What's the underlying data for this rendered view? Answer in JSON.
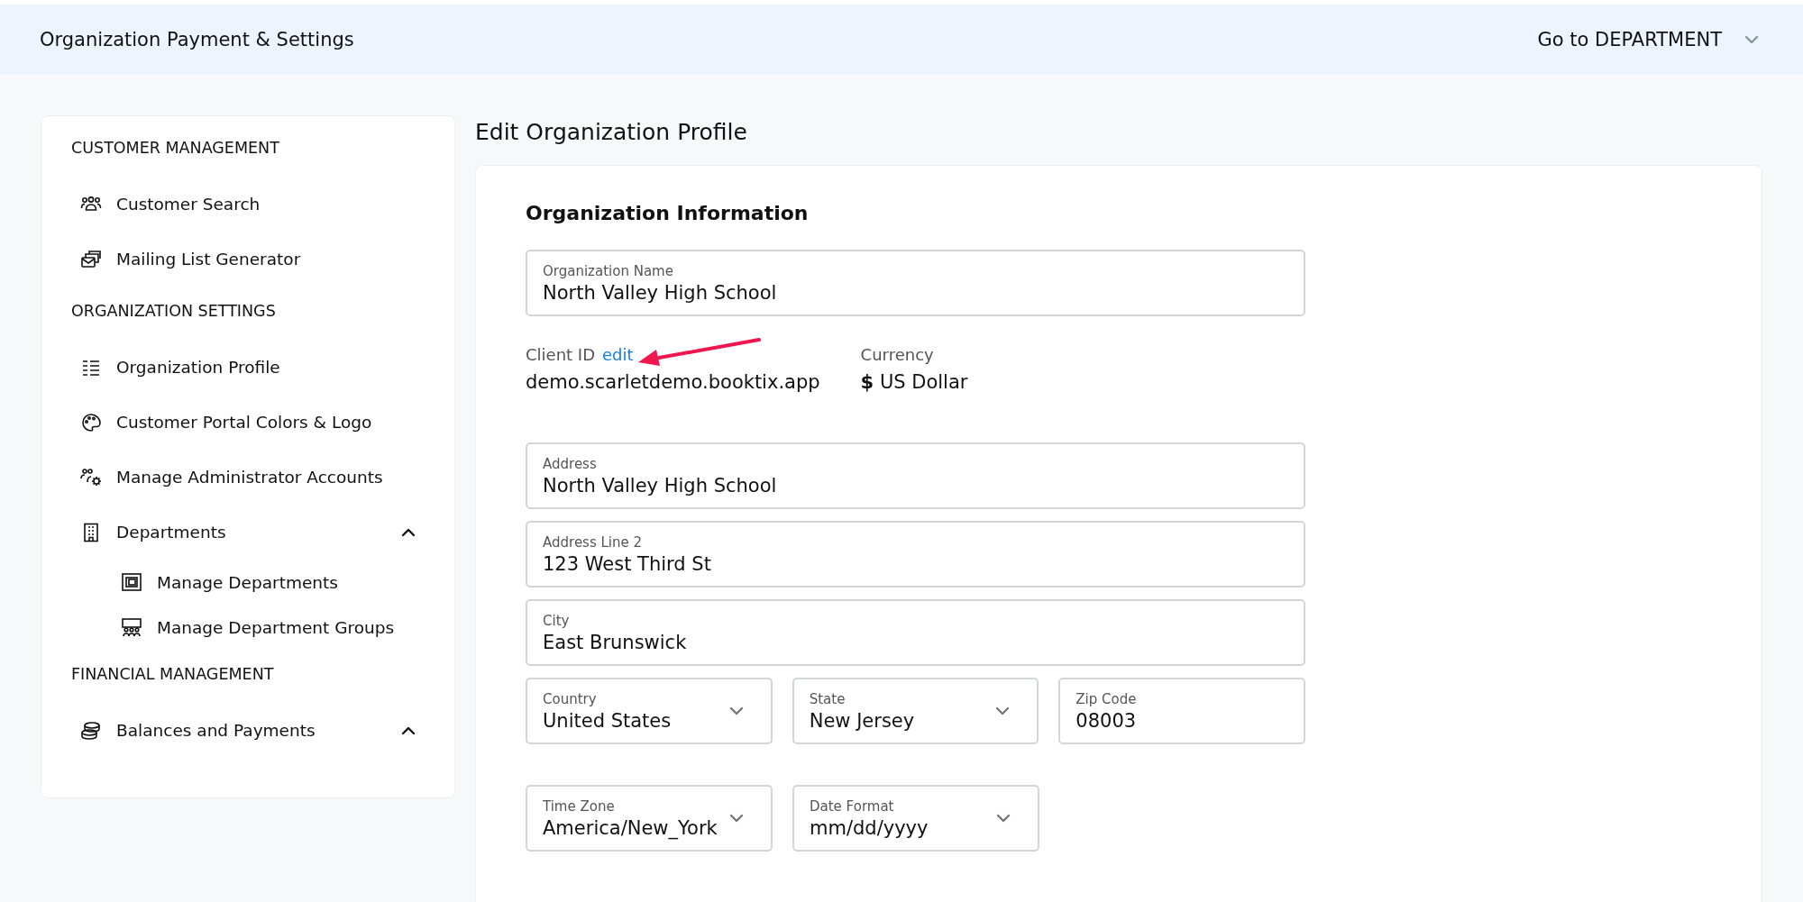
{
  "header": {
    "title": "Organization Payment & Settings",
    "department_menu": "Go to DEPARTMENT"
  },
  "sidebar": {
    "sections": [
      {
        "heading": "CUSTOMER MANAGEMENT",
        "items": [
          {
            "label": "Customer Search"
          },
          {
            "label": "Mailing List Generator"
          }
        ]
      },
      {
        "heading": "ORGANIZATION SETTINGS",
        "items": [
          {
            "label": "Organization Profile"
          },
          {
            "label": "Customer Portal Colors & Logo"
          },
          {
            "label": "Manage Administrator Accounts"
          },
          {
            "label": "Departments",
            "expanded": true,
            "children": [
              {
                "label": "Manage Departments"
              },
              {
                "label": "Manage Department Groups"
              }
            ]
          }
        ]
      },
      {
        "heading": "FINANCIAL MANAGEMENT",
        "items": [
          {
            "label": "Balances and Payments",
            "expanded": true
          }
        ]
      }
    ]
  },
  "page_title": "Edit Organization Profile",
  "form": {
    "title": "Organization Information",
    "name_field": {
      "label": "Organization Name",
      "value": "North Valley High School"
    },
    "info": [
      {
        "label": "Client ID",
        "link": "edit",
        "value": "demo.scarletdemo.booktix.app"
      },
      {
        "label": "Currency",
        "value": "**$** US Dollar"
      }
    ],
    "address_fields": [
      {
        "label": "Address",
        "value": "North Valley High School"
      },
      {
        "label": "Address Line 2",
        "value": "123 West Third St"
      },
      {
        "label": "City",
        "value": "East Brunswick"
      }
    ],
    "location_row": [
      {
        "kind": "select",
        "label": "Country",
        "value": "United States"
      },
      {
        "kind": "select",
        "label": "State",
        "value": "New Jersey"
      },
      {
        "kind": "text",
        "label": "Zip Code",
        "value": "08003"
      }
    ],
    "regional_row": [
      {
        "kind": "select",
        "label": "Time Zone",
        "value": "America/New_York"
      },
      {
        "kind": "select",
        "label": "Date Format",
        "value": "mm/dd/yyyy"
      }
    ]
  }
}
